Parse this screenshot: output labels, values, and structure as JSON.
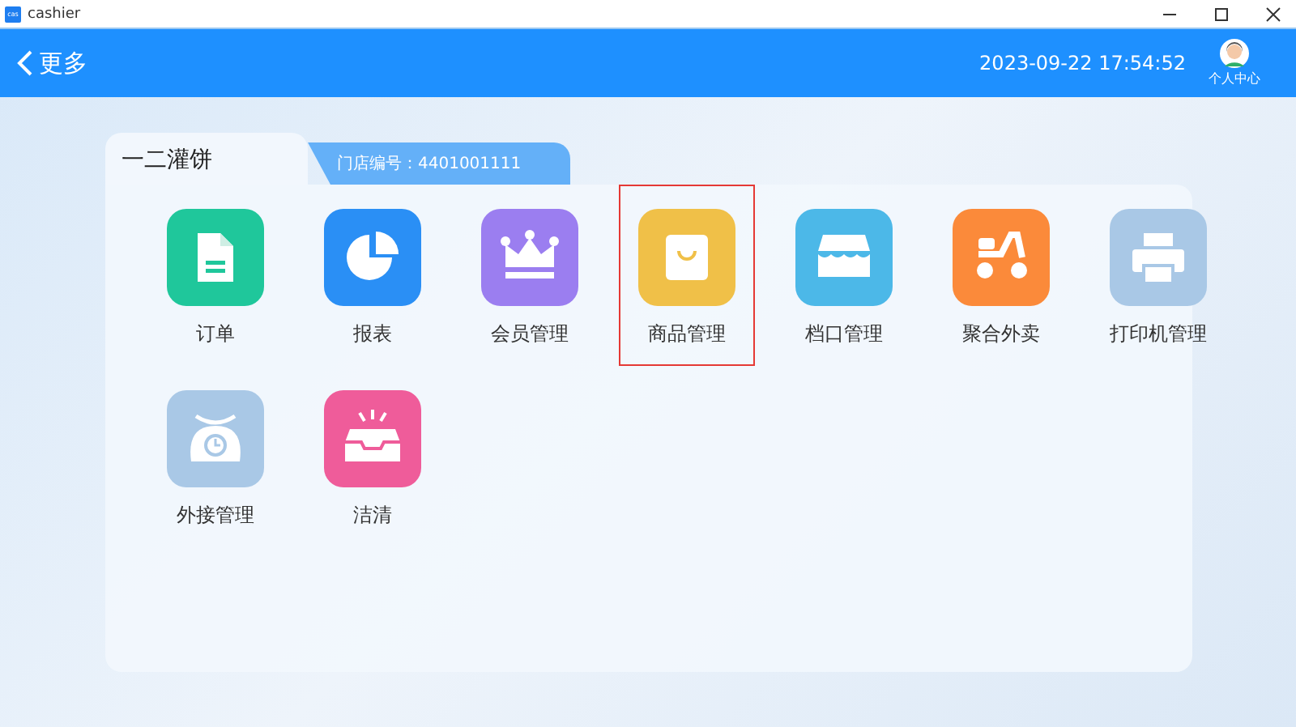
{
  "window": {
    "title": "cashier",
    "app_icon": "cas"
  },
  "header": {
    "back_label": "更多",
    "datetime": "2023-09-22 17:54:52",
    "profile_label": "个人中心"
  },
  "store": {
    "name": "一二灌饼",
    "number_label": "门店编号：4401001111"
  },
  "apps": [
    {
      "label": "订单",
      "kind": "document",
      "color": "#1fc79b",
      "selected": false
    },
    {
      "label": "报表",
      "kind": "pie",
      "color": "#2a8ff5",
      "selected": false
    },
    {
      "label": "会员管理",
      "kind": "crown",
      "color": "#9b7ef0",
      "selected": false
    },
    {
      "label": "商品管理",
      "kind": "bag",
      "color": "#f0c048",
      "selected": true
    },
    {
      "label": "档口管理",
      "kind": "shop",
      "color": "#4cb8e8",
      "selected": false
    },
    {
      "label": "聚合外卖",
      "kind": "scooter",
      "color": "#fb8a3a",
      "selected": false
    },
    {
      "label": "打印机管理",
      "kind": "printer",
      "color": "#a9c8e6",
      "selected": false
    },
    {
      "label": "外接管理",
      "kind": "scale",
      "color": "#a9c8e6",
      "selected": false
    },
    {
      "label": "洁清",
      "kind": "inbox",
      "color": "#ef5c9a",
      "selected": false
    }
  ]
}
